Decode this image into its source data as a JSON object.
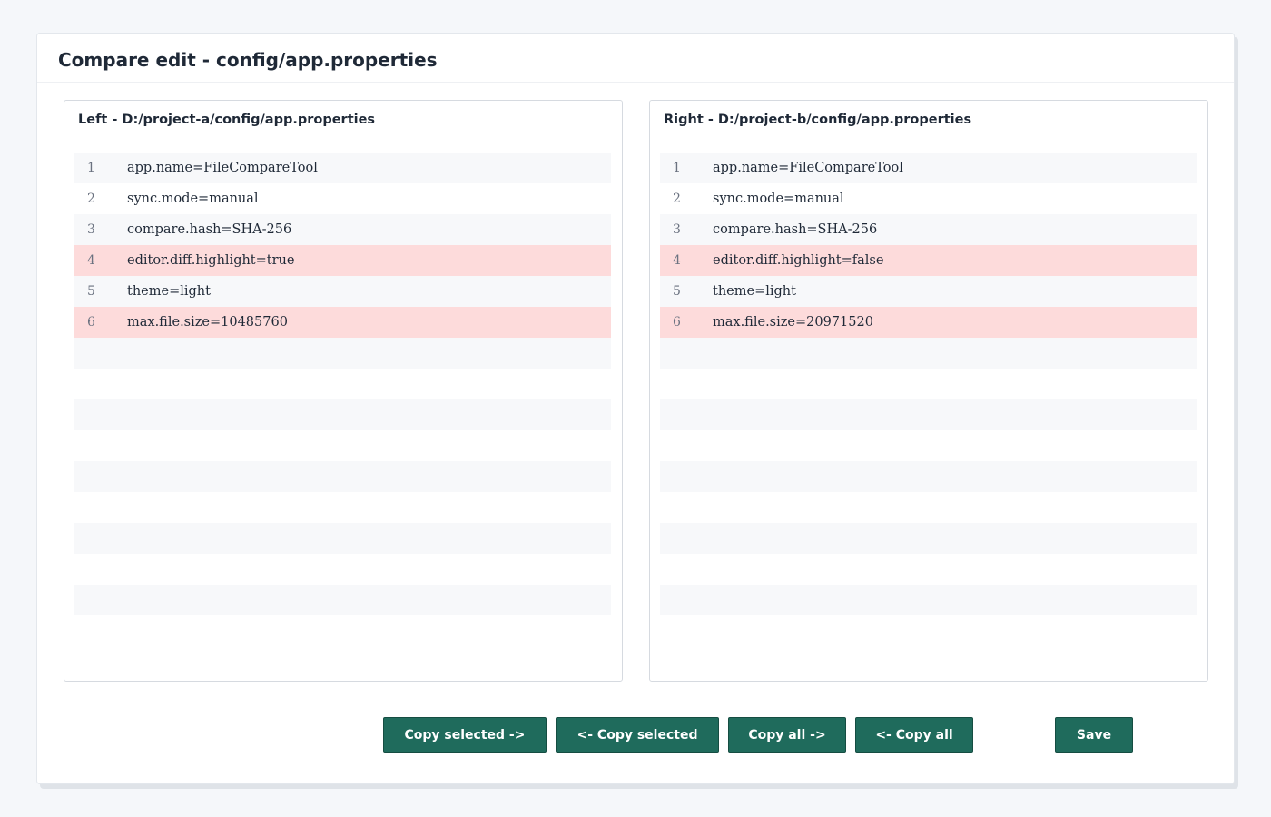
{
  "title": "Compare edit - config/app.properties",
  "left": {
    "title": "Left - D:/project-a/config/app.properties",
    "lines": [
      {
        "num": "1",
        "text": "app.name=FileCompareTool",
        "diff": false
      },
      {
        "num": "2",
        "text": "sync.mode=manual",
        "diff": false
      },
      {
        "num": "3",
        "text": "compare.hash=SHA-256",
        "diff": false
      },
      {
        "num": "4",
        "text": "editor.diff.highlight=true",
        "diff": true
      },
      {
        "num": "5",
        "text": "theme=light",
        "diff": false
      },
      {
        "num": "6",
        "text": "max.file.size=10485760",
        "diff": true
      }
    ]
  },
  "right": {
    "title": "Right - D:/project-b/config/app.properties",
    "lines": [
      {
        "num": "1",
        "text": "app.name=FileCompareTool",
        "diff": false
      },
      {
        "num": "2",
        "text": "sync.mode=manual",
        "diff": false
      },
      {
        "num": "3",
        "text": "compare.hash=SHA-256",
        "diff": false
      },
      {
        "num": "4",
        "text": "editor.diff.highlight=false",
        "diff": true
      },
      {
        "num": "5",
        "text": "theme=light",
        "diff": false
      },
      {
        "num": "6",
        "text": "max.file.size=20971520",
        "diff": true
      }
    ]
  },
  "buttons": {
    "copy_selected_right": "Copy selected ->",
    "copy_selected_left": "<- Copy selected",
    "copy_all_right": "Copy all ->",
    "copy_all_left": "<- Copy all",
    "save": "Save"
  },
  "colors": {
    "accent": "#1f6b5c",
    "diff_highlight": "#fddbdb"
  }
}
